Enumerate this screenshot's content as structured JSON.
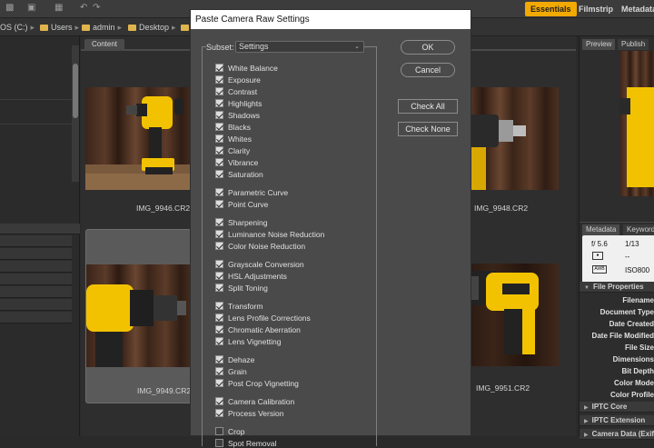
{
  "topbar": {
    "workspaces": [
      {
        "label": "Essentials",
        "active": true
      },
      {
        "label": "Filmstrip",
        "active": false
      },
      {
        "label": "Metadata",
        "active": false
      }
    ]
  },
  "path": {
    "drive": "OS (C:)",
    "segments": [
      "Users",
      "admin",
      "Desktop"
    ]
  },
  "content": {
    "tab": "Content",
    "thumbnails": [
      {
        "name": "IMG_9946.CR2",
        "selected": false
      },
      {
        "name": "IMG_9948.CR2",
        "selected": false
      },
      {
        "name": "IMG_9949.CR2",
        "selected": true
      },
      {
        "name": "IMG_9951.CR2",
        "selected": false
      }
    ]
  },
  "right": {
    "tabs_top": [
      "Preview",
      "Publish"
    ],
    "tabs_meta": [
      "Metadata",
      "Keywords"
    ],
    "exif": {
      "aperture": "f/ 5.6",
      "shutter": "1/13",
      "dash": "--",
      "iso": "ISO800",
      "awb": "AWB"
    },
    "file_properties_title": "File Properties",
    "properties": [
      "Filename",
      "Document Type",
      "Date Created",
      "Date File Modified",
      "File Size",
      "Dimensions",
      "Bit Depth",
      "Color Mode",
      "Color Profile"
    ],
    "sections": [
      "IPTC Core",
      "IPTC Extension",
      "Camera Data (Exif)"
    ]
  },
  "dialog": {
    "title": "Paste Camera Raw Settings",
    "subset_label": "Subset:",
    "subset_value": "Settings",
    "buttons": {
      "ok": "OK",
      "cancel": "Cancel",
      "check_all": "Check All",
      "check_none": "Check None"
    },
    "groups": [
      [
        {
          "label": "White Balance",
          "checked": true
        },
        {
          "label": "Exposure",
          "checked": true
        },
        {
          "label": "Contrast",
          "checked": true
        },
        {
          "label": "Highlights",
          "checked": true
        },
        {
          "label": "Shadows",
          "checked": true
        },
        {
          "label": "Blacks",
          "checked": true
        },
        {
          "label": "Whites",
          "checked": true
        },
        {
          "label": "Clarity",
          "checked": true
        },
        {
          "label": "Vibrance",
          "checked": true
        },
        {
          "label": "Saturation",
          "checked": true
        }
      ],
      [
        {
          "label": "Parametric Curve",
          "checked": true
        },
        {
          "label": "Point Curve",
          "checked": true
        }
      ],
      [
        {
          "label": "Sharpening",
          "checked": true
        },
        {
          "label": "Luminance Noise Reduction",
          "checked": true
        },
        {
          "label": "Color Noise Reduction",
          "checked": true
        }
      ],
      [
        {
          "label": "Grayscale Conversion",
          "checked": true
        },
        {
          "label": "HSL Adjustments",
          "checked": true
        },
        {
          "label": "Split Toning",
          "checked": true
        }
      ],
      [
        {
          "label": "Transform",
          "checked": true
        },
        {
          "label": "Lens Profile Corrections",
          "checked": true
        },
        {
          "label": "Chromatic Aberration",
          "checked": true
        },
        {
          "label": "Lens Vignetting",
          "checked": true
        }
      ],
      [
        {
          "label": "Dehaze",
          "checked": true
        },
        {
          "label": "Grain",
          "checked": true
        },
        {
          "label": "Post Crop Vignetting",
          "checked": true
        }
      ],
      [
        {
          "label": "Camera Calibration",
          "checked": true
        },
        {
          "label": "Process Version",
          "checked": true
        }
      ],
      [
        {
          "label": "Crop",
          "checked": false
        },
        {
          "label": "Spot Removal",
          "checked": false
        }
      ]
    ]
  }
}
